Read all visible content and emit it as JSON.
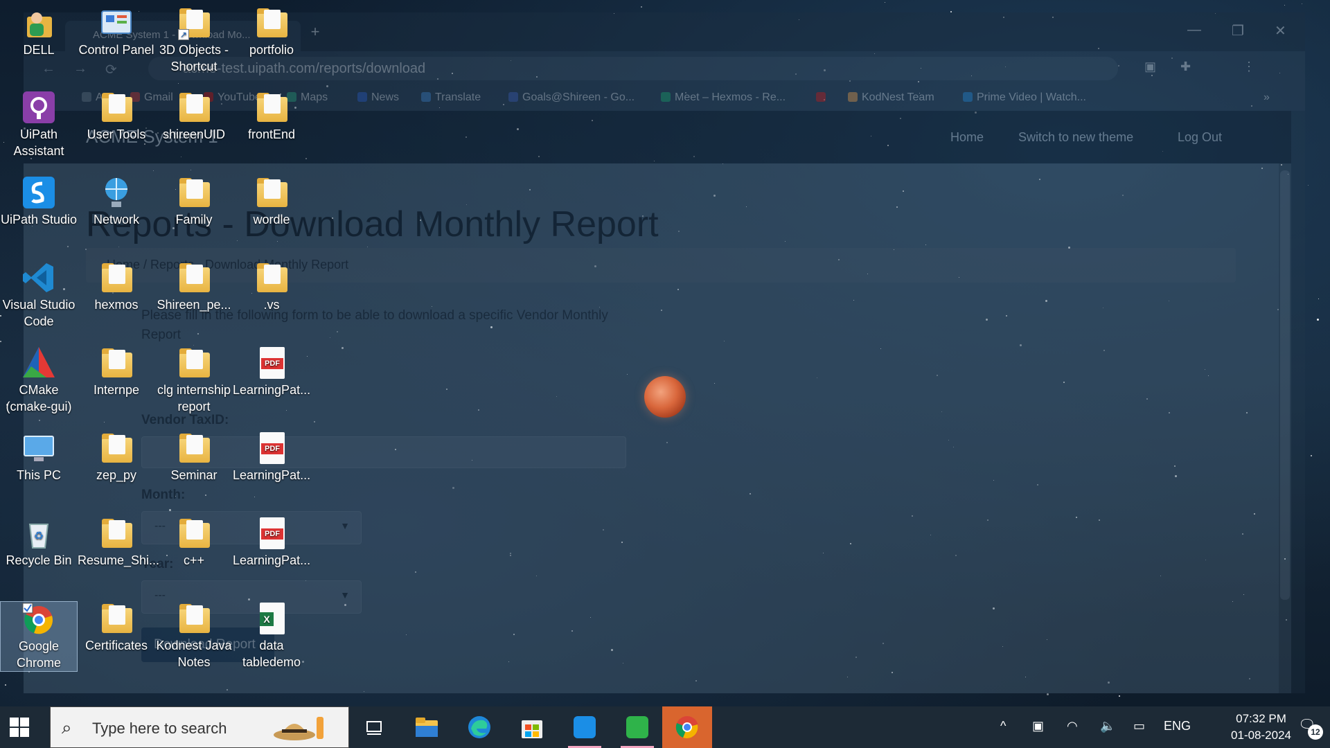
{
  "browser": {
    "tab_title": "ACME System 1 - Download Mo...",
    "new_tab": "+",
    "minimize": "—",
    "restore": "❐",
    "close": "✕",
    "back": "←",
    "forward": "→",
    "reload": "⟳",
    "url": "acme-test.uipath.com/reports/download",
    "bookmarks": [
      "Apps",
      "Gmail",
      "YouTube",
      "Maps",
      "News",
      "Translate",
      "Goals@Shireen - Go...",
      "Meet – Hexmos - Re...",
      "",
      "KodNest Team",
      "Prime Video | Watch..."
    ],
    "bookmarks_more": "»"
  },
  "site": {
    "brand": "ACME System 1",
    "nav": [
      "Home",
      "Switch to new theme",
      "Log Out"
    ],
    "page_title": "Reports - Download Monthly Report",
    "breadcrumb": "Home  /  Reports - Download Monthly Report",
    "intro": "Please fill in the following form to be able to download a specific Vendor Monthly Report",
    "vendor_label": "Vendor TaxID:",
    "vendor_value": "",
    "month_label": "Month:",
    "month_value": "---",
    "year_label": "Year:",
    "year_value": "---",
    "download_button": "Download Report"
  },
  "desktop": {
    "icons": [
      {
        "label": "DELL",
        "type": "person"
      },
      {
        "label": "Control Panel",
        "type": "control"
      },
      {
        "label": "3D Objects - Shortcut",
        "type": "folder-shortcut"
      },
      {
        "label": "portfolio",
        "type": "folder-chrome"
      },
      {
        "label": "UiPath Assistant",
        "type": "uipath-assistant"
      },
      {
        "label": "User Tools",
        "type": "folder"
      },
      {
        "label": "shireenUID",
        "type": "folder-chrome"
      },
      {
        "label": "frontEnd",
        "type": "folder"
      },
      {
        "label": "UiPath Studio",
        "type": "uipath-studio"
      },
      {
        "label": "Network",
        "type": "network"
      },
      {
        "label": "Family",
        "type": "folder"
      },
      {
        "label": "wordle",
        "type": "folder"
      },
      {
        "label": "Visual Studio Code",
        "type": "vscode"
      },
      {
        "label": "hexmos",
        "type": "folder"
      },
      {
        "label": "Shireen_pe...",
        "type": "folder"
      },
      {
        "label": ".vs",
        "type": "folder"
      },
      {
        "label": "CMake (cmake-gui)",
        "type": "cmake"
      },
      {
        "label": "Internpe",
        "type": "folder"
      },
      {
        "label": "clg internship report",
        "type": "folder"
      },
      {
        "label": "LearningPat...",
        "type": "pdf"
      },
      {
        "label": "This PC",
        "type": "pc"
      },
      {
        "label": "zep_py",
        "type": "folder"
      },
      {
        "label": "Seminar",
        "type": "folder"
      },
      {
        "label": "LearningPat...",
        "type": "pdf"
      },
      {
        "label": "Recycle Bin",
        "type": "recycle"
      },
      {
        "label": "Resume_Shi...",
        "type": "folder"
      },
      {
        "label": "c++",
        "type": "folder"
      },
      {
        "label": "LearningPat...",
        "type": "pdf"
      },
      {
        "label": "Google Chrome",
        "type": "chrome"
      },
      {
        "label": "Certificates",
        "type": "folder"
      },
      {
        "label": "Kodnest Java Notes",
        "type": "folder"
      },
      {
        "label": "data tabledemo",
        "type": "excel"
      }
    ],
    "selected_icon": "Google Chrome"
  },
  "taskbar": {
    "search_placeholder": "Type here to search",
    "apps": [
      "task-view",
      "file-explorer",
      "edge",
      "microsoft-store",
      "uipath-studio",
      "uipath-assistant",
      "chrome"
    ],
    "active_app": "chrome",
    "tray": {
      "chevron": "^",
      "language": "ENG",
      "time": "07:32 PM",
      "date": "01-08-2024",
      "notifications": "12"
    }
  },
  "colors": {
    "taskbar_bg": "#1d2a36",
    "active_app": "#d9652e",
    "moon": "#d9673c",
    "site_header": "#112233"
  }
}
